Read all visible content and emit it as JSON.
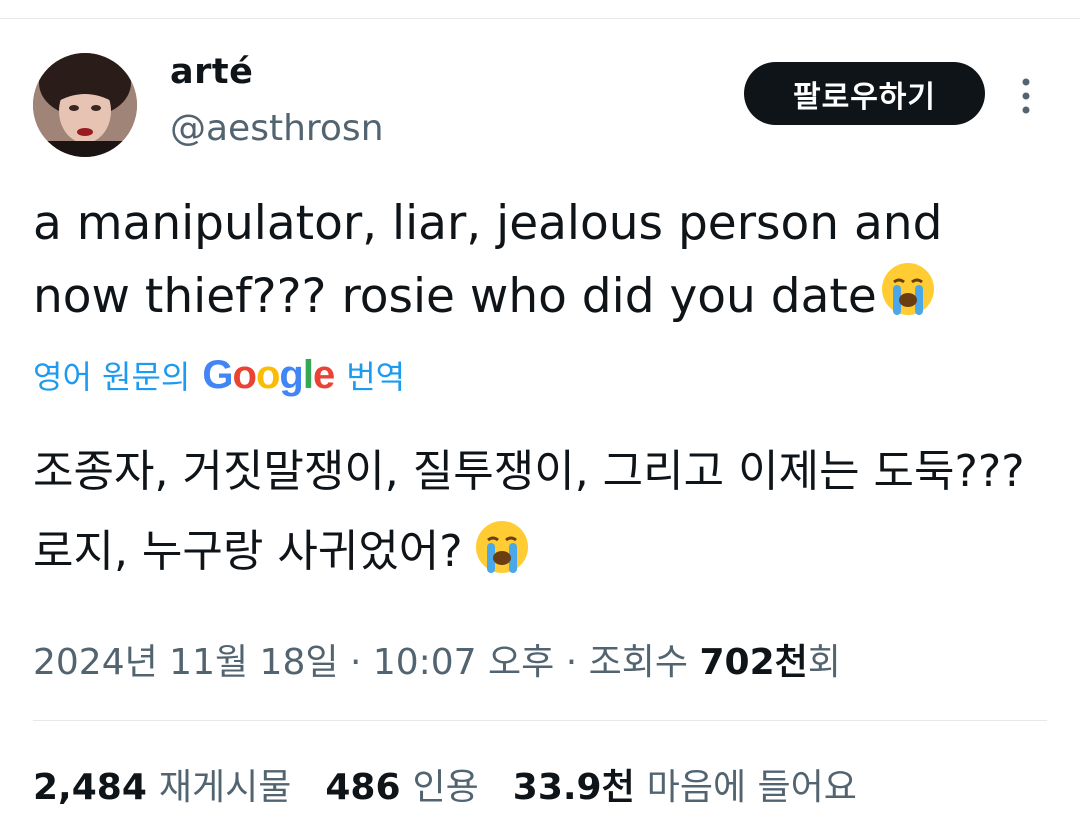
{
  "author": {
    "display_name": "arté",
    "handle": "@aesthrosn"
  },
  "follow_button_label": "팔로우하기",
  "tweet": {
    "text": "a manipulator, liar, jealous person and now thief??? rosie who did you date",
    "emoji": "loudly-crying-face"
  },
  "translate": {
    "prefix": "영어 원문의",
    "google": [
      "G",
      "o",
      "o",
      "g",
      "l",
      "e"
    ],
    "suffix": "번역"
  },
  "translated": {
    "text": "조종자, 거짓말쟁이, 질투쟁이, 그리고 이제는 도둑??? 로지, 누구랑 사귀었어?",
    "emoji": "loudly-crying-face"
  },
  "meta": {
    "date": "2024년 11월 18일",
    "sep1": "·",
    "time": "10:07 오후",
    "sep2": "·",
    "views_label": "조회수",
    "views_num": "702천",
    "views_suffix": "회"
  },
  "stats": {
    "reposts_num": "2,484",
    "reposts_label": "재게시물",
    "quotes_num": "486",
    "quotes_label": "인용",
    "likes_num": "33.9천",
    "likes_label": "마음에 들어요"
  },
  "colors": {
    "accent": "#1d9bf0",
    "text": "#0f1419",
    "secondary": "#536471",
    "button_bg": "#0f1419"
  }
}
